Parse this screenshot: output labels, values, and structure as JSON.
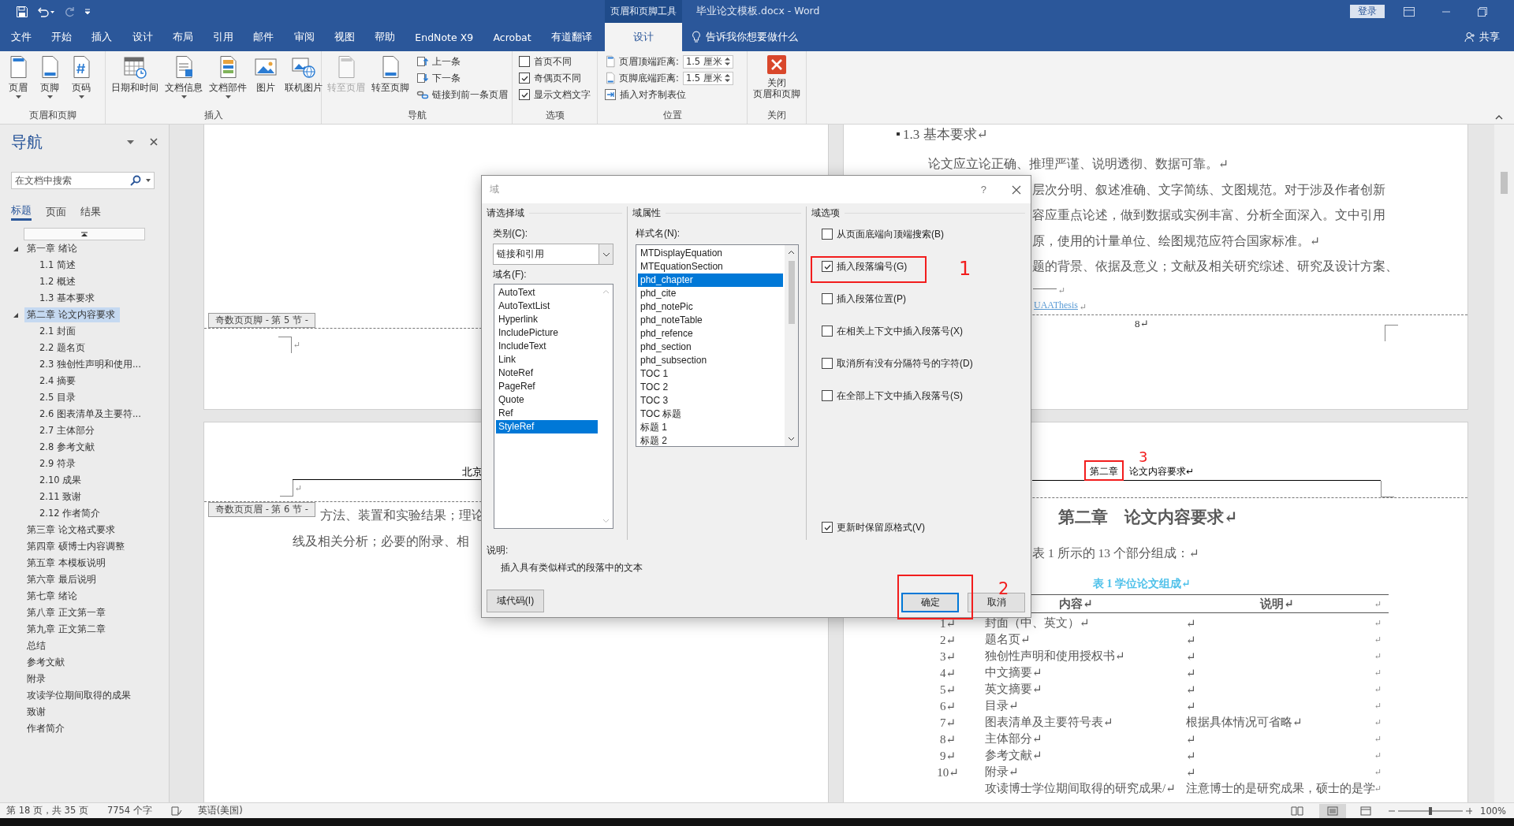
{
  "title_bar": {
    "context_group": "页眉和页脚工具",
    "title": "毕业论文模板.docx - Word",
    "sign_in": "登录"
  },
  "menu_tabs": [
    {
      "label": "文件",
      "selected": false,
      "contextual": false
    },
    {
      "label": "开始",
      "selected": false,
      "contextual": false
    },
    {
      "label": "插入",
      "selected": false,
      "contextual": false
    },
    {
      "label": "设计",
      "selected": false,
      "contextual": false
    },
    {
      "label": "布局",
      "selected": false,
      "contextual": false
    },
    {
      "label": "引用",
      "selected": false,
      "contextual": false
    },
    {
      "label": "邮件",
      "selected": false,
      "contextual": false
    },
    {
      "label": "审阅",
      "selected": false,
      "contextual": false
    },
    {
      "label": "视图",
      "selected": false,
      "contextual": false
    },
    {
      "label": "帮助",
      "selected": false,
      "contextual": false
    },
    {
      "label": "EndNote X9",
      "selected": false,
      "contextual": false
    },
    {
      "label": "Acrobat",
      "selected": false,
      "contextual": false
    },
    {
      "label": "有道翻译",
      "selected": false,
      "contextual": false
    },
    {
      "label": "设计",
      "selected": true,
      "contextual": true
    }
  ],
  "tell_me": {
    "placeholder": "告诉我你想要做什么"
  },
  "share": "共享",
  "ribbon": {
    "groups": [
      {
        "label": "页眉和页脚",
        "items": [
          {
            "kind": "large",
            "label": "页眉",
            "dropdown": true,
            "disabled": false
          },
          {
            "kind": "large",
            "label": "页脚",
            "dropdown": true,
            "disabled": false
          },
          {
            "kind": "large",
            "label": "页码",
            "dropdown": true,
            "disabled": false
          }
        ]
      },
      {
        "label": "插入",
        "items": [
          {
            "kind": "large",
            "label": "日期和时间",
            "dropdown": false,
            "disabled": false
          },
          {
            "kind": "large",
            "label": "文档信息",
            "dropdown": true,
            "disabled": false
          },
          {
            "kind": "large",
            "label": "文档部件",
            "dropdown": true,
            "disabled": false
          },
          {
            "kind": "large",
            "label": "图片",
            "dropdown": false,
            "disabled": false
          },
          {
            "kind": "large",
            "label": "联机图片",
            "dropdown": false,
            "disabled": false
          }
        ]
      },
      {
        "label": "导航",
        "items": [
          {
            "kind": "large",
            "label": "转至页眉",
            "dropdown": false,
            "disabled": true
          },
          {
            "kind": "large",
            "label": "转至页脚",
            "dropdown": false,
            "disabled": false
          },
          {
            "kind": "stack",
            "entries": [
              {
                "kind": "small",
                "label": "上一条",
                "disabled": false
              },
              {
                "kind": "small",
                "label": "下一条",
                "disabled": false
              },
              {
                "kind": "small",
                "label": "链接到前一条页眉",
                "disabled": false
              }
            ]
          }
        ]
      },
      {
        "label": "选项",
        "items": [
          {
            "kind": "stack",
            "entries": [
              {
                "kind": "checkbox",
                "label": "首页不同",
                "checked": false
              },
              {
                "kind": "checkbox",
                "label": "奇偶页不同",
                "checked": true
              },
              {
                "kind": "checkbox",
                "label": "显示文档文字",
                "checked": true
              }
            ]
          }
        ]
      },
      {
        "label": "位置",
        "items": [
          {
            "kind": "stack",
            "entries": [
              {
                "kind": "spinner",
                "label": "页眉顶端距离:",
                "value": "1.5 厘米"
              },
              {
                "kind": "spinner",
                "label": "页脚底端距离:",
                "value": "1.5 厘米"
              },
              {
                "kind": "small",
                "label": "插入对齐制表位",
                "disabled": false
              }
            ]
          }
        ]
      },
      {
        "label": "关闭",
        "items": [
          {
            "kind": "large",
            "label": "关闭",
            "label_line_2": "页眉和页脚",
            "dropdown": false,
            "disabled": false
          }
        ]
      }
    ]
  },
  "navigation": {
    "title": "导航",
    "search": {
      "placeholder": "在文档中搜索"
    },
    "tabs": [
      {
        "label": "标题",
        "selected": true
      },
      {
        "label": "页面",
        "selected": false
      },
      {
        "label": "结果",
        "selected": false
      }
    ],
    "headings": [
      {
        "label": "第一章 绪论",
        "selected": false,
        "expanded": true,
        "children": [
          {
            "label": "1.1 简述",
            "selected": false
          },
          {
            "label": "1.2 概述",
            "selected": false
          },
          {
            "label": "1.3 基本要求",
            "selected": false
          }
        ]
      },
      {
        "label": "第二章 论文内容要求",
        "selected": true,
        "expanded": true,
        "children": [
          {
            "label": "2.1 封面",
            "selected": false
          },
          {
            "label": "2.2 题名页",
            "selected": false
          },
          {
            "label": "2.3 独创性声明和使用...",
            "selected": false
          },
          {
            "label": "2.4 摘要",
            "selected": false
          },
          {
            "label": "2.5 目录",
            "selected": false
          },
          {
            "label": "2.6 图表清单及主要符...",
            "selected": false
          },
          {
            "label": "2.7 主体部分",
            "selected": false
          },
          {
            "label": "2.8 参考文献",
            "selected": false
          },
          {
            "label": "2.9 符录",
            "selected": false
          },
          {
            "label": "2.10 成果",
            "selected": false
          },
          {
            "label": "2.11 致谢",
            "selected": false
          },
          {
            "label": "2.12 作者简介",
            "selected": false
          }
        ]
      },
      {
        "label": "第三章 论文格式要求",
        "selected": false
      },
      {
        "label": "第四章 硕博士内容调整",
        "selected": false
      },
      {
        "label": "第五章 本模板说明",
        "selected": false
      },
      {
        "label": "第六章 最后说明",
        "selected": false
      },
      {
        "label": "第七章 绪论",
        "selected": false
      },
      {
        "label": "第八章 正文第一章",
        "selected": false
      },
      {
        "label": "第九章 正文第二章",
        "selected": false
      },
      {
        "label": "总结",
        "selected": false
      },
      {
        "label": "参考文献",
        "selected": false
      },
      {
        "label": "附录",
        "selected": false
      },
      {
        "label": "攻读学位期间取得的成果",
        "selected": false
      },
      {
        "label": "致谢",
        "selected": false
      },
      {
        "label": "作者简介",
        "selected": false
      }
    ]
  },
  "document": {
    "left_pages": {
      "footer_label": "奇数页页脚 - 第 5 节 -",
      "footer_return": "↵",
      "header_text": "北京",
      "header_return": "↵",
      "header_label": "奇数页页眉 - 第 6 节 -",
      "lines": [
        "方法、装置和实验结果；理论",
        "线及相关分析；必要的附录、相"
      ]
    },
    "right_top_page": {
      "heading": "1.3 基本要求↵",
      "lines": [
        "论文应立论正确、推理严谨、说明透彻、数据可靠。↵",
        "层次分明、叙述准确、文字简练、文图规范。对于涉及作者创新",
        "容应重点论述，做到数据或实例丰富、分析全面深入。文中引用",
        "原，使用的计量单位、绘图规范应符合国家标准。↵",
        "题的背景、依据及意义；文献及相关研究综述、研究及设计方案、"
      ],
      "separator_return": "↵",
      "link": "UAAThesis",
      "link_return": "↵",
      "page_number": "8↵"
    },
    "right_bottom_page": {
      "header_field": "第二章",
      "header_text": "论文内容要求↵",
      "heading": "第二章　论文内容要求↵",
      "intro": "表 1 所示的 13 个部分组成：↵",
      "table": {
        "caption": "表 1 学位论文组成↵",
        "columns": [
          "内容↵",
          "说明↵"
        ],
        "header_end": "↵",
        "rows": [
          {
            "number": "1↵",
            "content": "封面（中、英文）↵",
            "note": "↵",
            "end": "↵"
          },
          {
            "number": "2↵",
            "content": "题名页↵",
            "note": "↵",
            "end": "↵"
          },
          {
            "number": "3↵",
            "content": "独创性声明和使用授权书↵",
            "note": "↵",
            "end": "↵"
          },
          {
            "number": "4↵",
            "content": "中文摘要↵",
            "note": "↵",
            "end": "↵"
          },
          {
            "number": "5↵",
            "content": "英文摘要↵",
            "note": "↵",
            "end": "↵"
          },
          {
            "number": "6↵",
            "content": "目录↵",
            "note": "↵",
            "end": "↵"
          },
          {
            "number": "7↵",
            "content": "图表清单及主要符号表↵",
            "note": "根据具体情况可省略↵",
            "end": "↵"
          },
          {
            "number": "8↵",
            "content": "主体部分↵",
            "note": "↵",
            "end": "↵"
          },
          {
            "number": "9↵",
            "content": "参考文献↵",
            "note": "↵",
            "end": "↵"
          },
          {
            "number": "10↵",
            "content": "附录↵",
            "note": "↵",
            "end": "↵"
          },
          {
            "content": "攻读博士学位期间取得的研究成果/↵",
            "note": "注意博士的是研究成果，硕士的是学",
            "end": "↵"
          }
        ]
      }
    }
  },
  "dialog": {
    "title": "域",
    "help": "?",
    "choose": {
      "heading": "请选择域",
      "category_label": "类别(C):",
      "category": "链接和引用",
      "field_names_label": "域名(F):",
      "field_names": [
        {
          "label": "AutoText",
          "selected": false
        },
        {
          "label": "AutoTextList",
          "selected": false
        },
        {
          "label": "Hyperlink",
          "selected": false
        },
        {
          "label": "IncludePicture",
          "selected": false
        },
        {
          "label": "IncludeText",
          "selected": false
        },
        {
          "label": "Link",
          "selected": false
        },
        {
          "label": "NoteRef",
          "selected": false
        },
        {
          "label": "PageRef",
          "selected": false
        },
        {
          "label": "Quote",
          "selected": false
        },
        {
          "label": "Ref",
          "selected": false
        },
        {
          "label": "StyleRef",
          "selected": true
        }
      ]
    },
    "properties": {
      "heading": "域属性",
      "style_name_label": "样式名(N):",
      "style_names": [
        {
          "label": "MTDisplayEquation",
          "selected": false
        },
        {
          "label": "MTEquationSection",
          "selected": false
        },
        {
          "label": "phd_chapter",
          "selected": true
        },
        {
          "label": "phd_cite",
          "selected": false
        },
        {
          "label": "phd_notePic",
          "selected": false
        },
        {
          "label": "phd_noteTable",
          "selected": false
        },
        {
          "label": "phd_refence",
          "selected": false
        },
        {
          "label": "phd_section",
          "selected": false
        },
        {
          "label": "phd_subsection",
          "selected": false
        },
        {
          "label": "TOC 1",
          "selected": false
        },
        {
          "label": "TOC 2",
          "selected": false
        },
        {
          "label": "TOC 3",
          "selected": false
        },
        {
          "label": "TOC 标题",
          "selected": false
        },
        {
          "label": "标题 1",
          "selected": false
        },
        {
          "label": "标题 2",
          "selected": false
        }
      ]
    },
    "options": {
      "heading": "域选项",
      "checkboxes": [
        {
          "label": "从页面底端向顶端搜索(B)",
          "checked": false
        },
        {
          "label": "插入段落编号(G)",
          "checked": true
        },
        {
          "label": "插入段落位置(P)",
          "checked": false
        },
        {
          "label": "在相关上下文中插入段落号(X)",
          "checked": false
        },
        {
          "label": "取消所有没有分隔符号的字符(D)",
          "checked": false
        },
        {
          "label": "在全部上下文中插入段落号(S)",
          "checked": false
        }
      ],
      "preserve": {
        "label": "更新时保留原格式(V)",
        "checked": true
      }
    },
    "description_label": "说明:",
    "description": "插入具有类似样式的段落中的文本",
    "field_codes_button": "域代码(I)",
    "buttons": [
      {
        "label": "确定",
        "default": true
      },
      {
        "label": "取消",
        "default": false
      }
    ]
  },
  "annotations": [
    {
      "label": "1"
    },
    {
      "label": "2"
    },
    {
      "label": "3"
    }
  ],
  "status_bar": {
    "page": "第 18 页，共 35 页",
    "words": "7754 个字",
    "language": "英语(美国)",
    "zoom_slider": {
      "level": 0.5
    },
    "zoom": "100%"
  }
}
